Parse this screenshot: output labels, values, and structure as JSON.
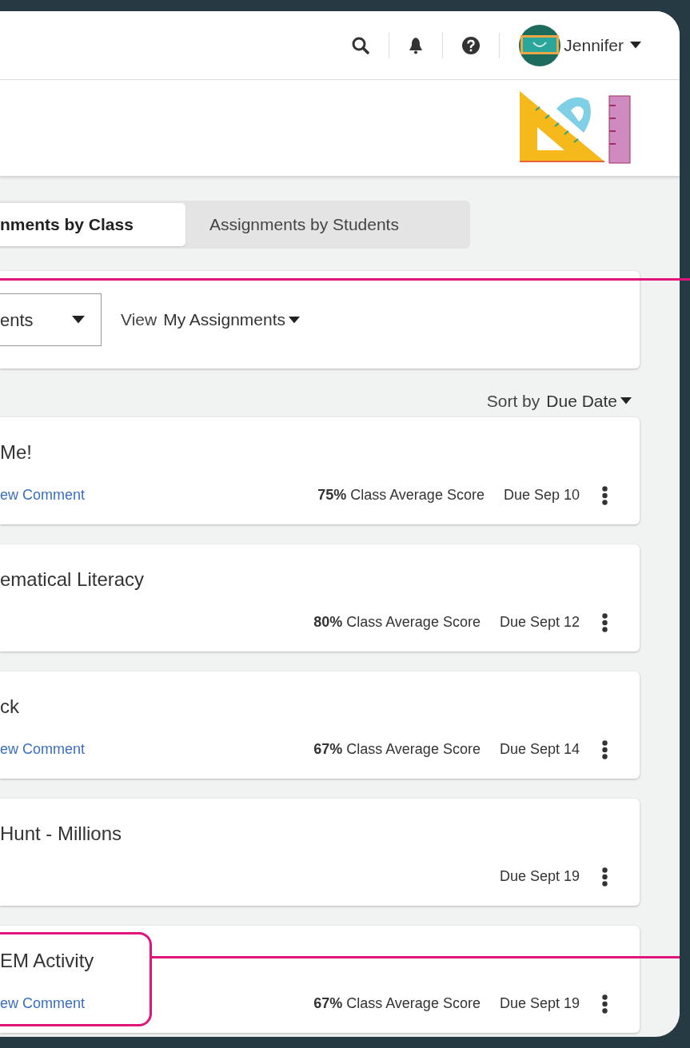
{
  "header": {
    "user_name": "Jennifer"
  },
  "tabs": [
    {
      "label": "nments by Class",
      "selected": true
    },
    {
      "label": "Assignments by Students",
      "selected": false
    }
  ],
  "filters": {
    "select_value": "ents",
    "view_label": "View",
    "view_value": "My Assignments"
  },
  "sort": {
    "label": "Sort by",
    "value": "Due Date"
  },
  "assignments": [
    {
      "title": "Me!",
      "comment": "ew Comment",
      "score": "75%",
      "score_label": "Class Average Score",
      "due": "Due Sep 10",
      "highlighted": false
    },
    {
      "title": "ematical Literacy",
      "score": "80%",
      "score_label": "Class Average Score",
      "due": "Due Sept 12",
      "highlighted": false
    },
    {
      "title": "ck",
      "comment": "ew Comment",
      "score": "67%",
      "score_label": "Class Average Score",
      "due": "Due Sept 14",
      "highlighted": false
    },
    {
      "title": "Hunt - Millions",
      "due": "Due Sept 19",
      "highlighted": false
    },
    {
      "title": "EM Activity",
      "comment": "ew Comment",
      "score": "67%",
      "score_label": "Class Average Score",
      "due": "Due Sept 19",
      "highlighted": true
    }
  ]
}
